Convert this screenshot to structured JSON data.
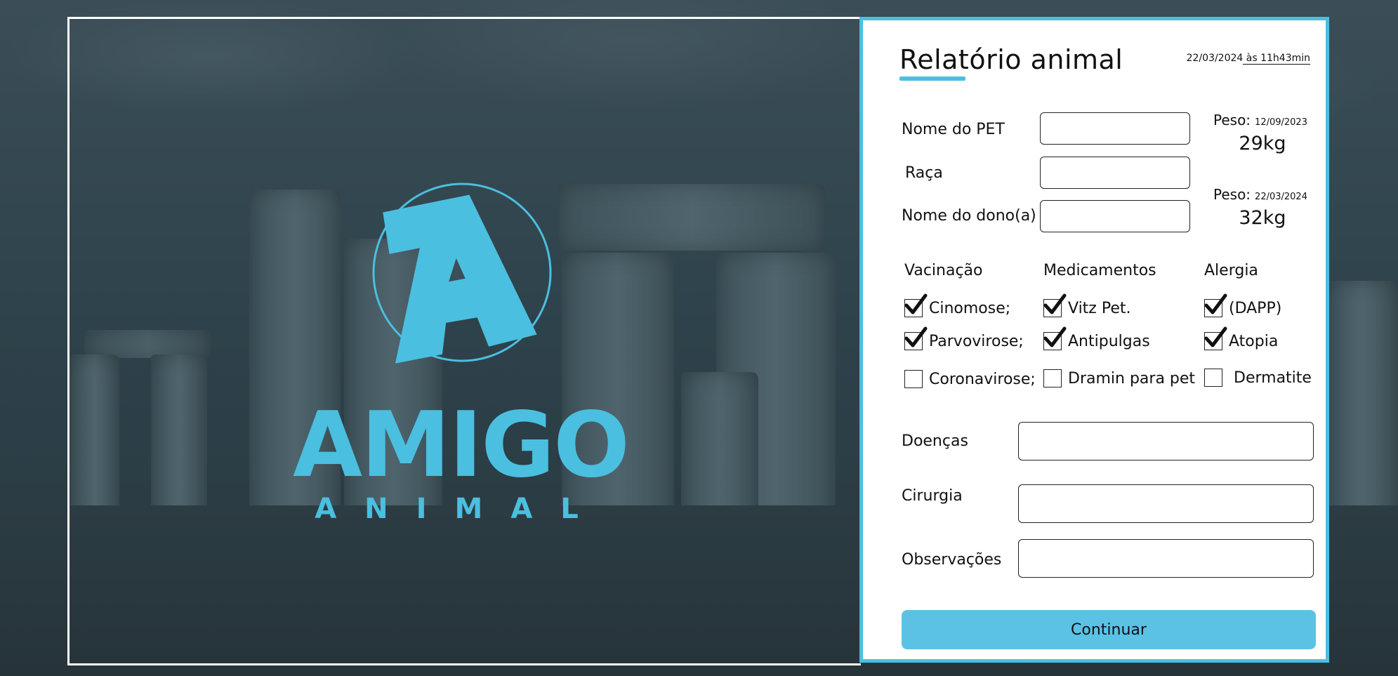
{
  "brand": {
    "logo_text": "AMIGO",
    "logo_subtext": "ANIMAL",
    "accent_color": "#4bbfe0"
  },
  "report": {
    "title": "Relatório animal",
    "date": "22/03/2024",
    "time_sep": " às ",
    "time": "11h43min"
  },
  "fields": {
    "pet_name_label": "Nome do PET",
    "breed_label": "Raça",
    "owner_label": "Nome do dono(a)",
    "pet_name_value": "",
    "breed_value": "",
    "owner_value": ""
  },
  "weights": [
    {
      "label": "Peso:",
      "date": "12/09/2023",
      "value": "29kg"
    },
    {
      "label": "Peso:",
      "date": "22/03/2024",
      "value": "32kg"
    }
  ],
  "checklists": {
    "vaccination": {
      "header": "Vacinação",
      "items": [
        {
          "label": "Cinomose;",
          "checked": true
        },
        {
          "label": "Parvovirose;",
          "checked": true
        },
        {
          "label": "Coronavirose;",
          "checked": false
        }
      ]
    },
    "medication": {
      "header": "Medicamentos",
      "items": [
        {
          "label": "Vitz Pet.",
          "checked": true
        },
        {
          "label": "Antipulgas",
          "checked": true
        },
        {
          "label": "Dramin para pet",
          "checked": false
        }
      ]
    },
    "allergy": {
      "header": "Alergia",
      "items": [
        {
          "label": "(DAPP)",
          "checked": true
        },
        {
          "label": "Atopia",
          "checked": true
        },
        {
          "label": "Dermatite",
          "checked": false
        }
      ]
    }
  },
  "notes": {
    "diseases_label": "Doenças",
    "surgery_label": "Cirurgia",
    "observations_label": "Observações",
    "diseases_value": "",
    "surgery_value": "",
    "observations_value": ""
  },
  "actions": {
    "continue_label": "Continuar"
  }
}
